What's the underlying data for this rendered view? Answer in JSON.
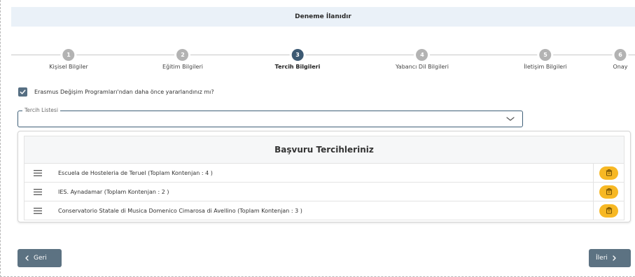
{
  "page": {
    "title": "Deneme İlanıdır"
  },
  "stepper": {
    "steps": [
      {
        "num": "1",
        "label": "Kişisel Bilgiler"
      },
      {
        "num": "2",
        "label": "Eğitim Bilgileri"
      },
      {
        "num": "3",
        "label": "Tercih Bilgileri"
      },
      {
        "num": "4",
        "label": "Yabancı Dil Bilgileri"
      },
      {
        "num": "5",
        "label": "İletişim Bilgileri"
      },
      {
        "num": "6",
        "label": "Onay"
      }
    ],
    "active_index": 2
  },
  "erasmus_check": {
    "checked": true,
    "label": "Erasmus Değişim Programları'ndan daha önce yararlandınız mı?"
  },
  "preference_select": {
    "legend": "Tercih Listesi",
    "value": ""
  },
  "preferences_panel": {
    "header": "Başvuru Tercihleriniz",
    "rows": [
      {
        "text": "Escuela de Hosteleria de Teruel (Toplam Kontenjan : 4 )"
      },
      {
        "text": "IES. Aynadamar (Toplam Kontenjan : 2 )"
      },
      {
        "text": "Conservatorio Statale di Musica Domenico Cimarosa di Avellino (Toplam Kontenjan : 3 )"
      }
    ]
  },
  "nav": {
    "back_label": "Geri",
    "next_label": "İleri"
  },
  "colors": {
    "accent": "#3d5a73",
    "button": "#5c7282",
    "delete": "#f7b824",
    "header_bg": "#eaf1f8"
  }
}
